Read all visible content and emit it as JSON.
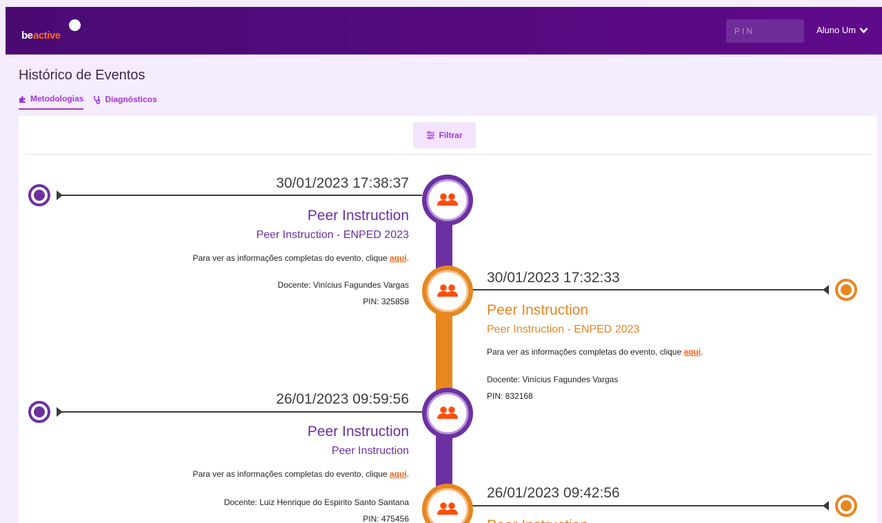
{
  "header": {
    "logo_be": "be",
    "logo_active": "active",
    "pin_placeholder": "PIN",
    "user_name": "Aluno Um"
  },
  "page": {
    "title": "Histórico de Eventos",
    "tabs": [
      {
        "label": "Metodologias",
        "icon": "puzzle-icon"
      },
      {
        "label": "Diagnósticos",
        "icon": "stethoscope-icon"
      }
    ],
    "filter_label": "Filtrar"
  },
  "colors": {
    "purple": "#6a2fa0",
    "orange": "#e8861f",
    "accent": "#a135d8",
    "link": "#ff5a0a"
  },
  "events": [
    {
      "date": "30/01/2023 17:38:37",
      "title": "Peer Instruction",
      "subtitle": "Peer Instruction - ENPED 2023",
      "info_text": "Para ver as informações completas do evento, clique",
      "link": "aqui",
      "docente": "Docente: Vinícius Fagundes Vargas",
      "pin": "PIN: 325858",
      "side": "left"
    },
    {
      "date": "30/01/2023 17:32:33",
      "title": "Peer Instruction",
      "subtitle": "Peer Instruction - ENPED 2023",
      "info_text": "Para ver as informações completas do evento, clique",
      "link": "aqui",
      "docente": "Docente: Vinícius Fagundes Vargas",
      "pin": "PIN: 832168",
      "side": "right"
    },
    {
      "date": "26/01/2023 09:59:56",
      "title": "Peer Instruction",
      "subtitle": "Peer Instruction",
      "info_text": "Para ver as informações completas do evento, clique",
      "link": "aqui",
      "docente": "Docente: Luiz Henrique do Espirito Santo Santana",
      "pin": "PIN: 475456",
      "side": "left"
    },
    {
      "date": "26/01/2023 09:42:56",
      "title": "Peer Instruction",
      "side": "right"
    }
  ]
}
